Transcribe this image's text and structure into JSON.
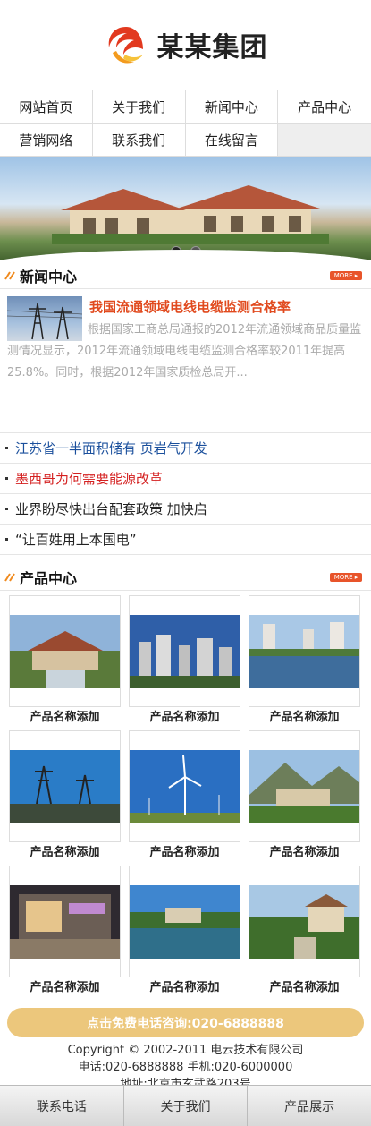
{
  "brand": {
    "name": "某某集团"
  },
  "nav": {
    "row1": [
      "网站首页",
      "关于我们",
      "新闻中心",
      "产品中心"
    ],
    "row2": [
      "营销网络",
      "联系我们",
      "在线留言"
    ]
  },
  "news": {
    "title": "新闻中心",
    "more": "MORE ▸",
    "feature_title": "我国流通领域电线电缆监测合格率",
    "feature_summary": "根据国家工商总局通报的2012年流通领域商品质量监测情况显示，2012年流通领域电线电缆监测合格率较2011年提高25.8%。同时，根据2012年国家质检总局开...",
    "items": [
      {
        "text": "江苏省一半面积储有 页岩气开发",
        "color": "#1a4f9c"
      },
      {
        "text": "墨西哥为何需要能源改革",
        "color": "#d42020"
      },
      {
        "text": "业界盼尽快出台配套政策 加快启",
        "color": "#222222"
      },
      {
        "text": "“让百姓用上本国电”",
        "color": "#222222"
      }
    ]
  },
  "products": {
    "title": "产品中心",
    "more": "MORE ▸",
    "items": [
      {
        "name": "产品名称添加"
      },
      {
        "name": "产品名称添加"
      },
      {
        "name": "产品名称添加"
      },
      {
        "name": "产品名称添加"
      },
      {
        "name": "产品名称添加"
      },
      {
        "name": "产品名称添加"
      },
      {
        "name": "产品名称添加"
      },
      {
        "name": "产品名称添加"
      },
      {
        "name": "产品名称添加"
      }
    ]
  },
  "call": {
    "label": "点击免费电话咨询:020-6888888"
  },
  "footer": {
    "copyright": "Copyright © 2002-2011 电云技术有限公司",
    "phones": "电话:020-6888888  手机:020-6000000",
    "address": "地址:北京市玄武路203号"
  },
  "bottom_bar": [
    "联系电话",
    "关于我们",
    "产品展示"
  ],
  "colors": {
    "accent": "#e14a1e",
    "call_button": "#ecc77c",
    "more_badge": "#e8542a"
  }
}
